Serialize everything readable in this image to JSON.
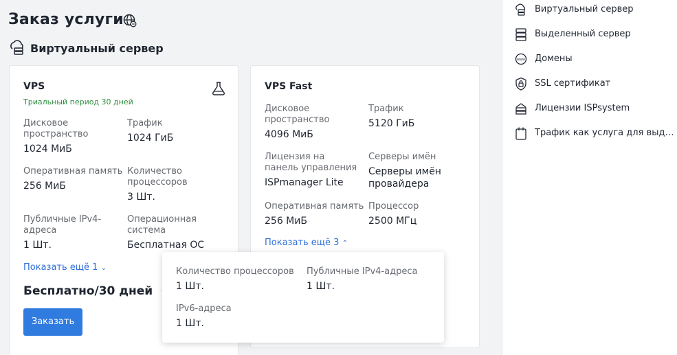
{
  "page": {
    "title": "Заказ услуги",
    "section": "Виртуальный сервер"
  },
  "vps": {
    "name": "VPS",
    "trial": "Триальный период 30 дней",
    "disk_label": "Дисковое пространство",
    "disk_value": "1024 МиБ",
    "traffic_label": "Трафик",
    "traffic_value": "1024 ГиБ",
    "ram_label": "Оперативная память",
    "ram_value": "256 МиБ",
    "cpu_label": "Количество процессоров",
    "cpu_value": "3 Шт.",
    "ipv4_label": "Публичные IPv4-адреса",
    "ipv4_value": "1 Шт.",
    "os_label": "Операционная система",
    "os_value": "Бесплатная ОС",
    "show_more": "Показать ещё 1",
    "price": "Бесплатно/30 дней",
    "order": "Заказать"
  },
  "vps_fast": {
    "name": "VPS Fast",
    "disk_label": "Дисковое пространство",
    "disk_value": "4096 МиБ",
    "traffic_label": "Трафик",
    "traffic_value": "5120 ГиБ",
    "license_label": "Лицензия на панель управления",
    "license_value": "ISPmanager Lite",
    "ns_label": "Серверы имён",
    "ns_value": "Серверы имён провайдера",
    "ram_label": "Оперативная память",
    "ram_value": "256 МиБ",
    "cpu_label": "Процессор",
    "cpu_value": "2500 МГц",
    "show_more": "Показать ещё 3"
  },
  "popup": {
    "cpu_count_label": "Количество процессоров",
    "cpu_count_value": "1 Шт.",
    "ipv4_label": "Публичные IPv4-адреса",
    "ipv4_value": "1 Шт.",
    "ipv6_label": "IPv6-адреса",
    "ipv6_value": "1 Шт."
  },
  "sidebar": {
    "items": [
      {
        "label": "Виртуальный сервер",
        "icon": "cloud-server-icon"
      },
      {
        "label": "Выделенный сервер",
        "icon": "server-icon"
      },
      {
        "label": "Домены",
        "icon": "www-globe-icon"
      },
      {
        "label": "SSL сертификат",
        "icon": "shield-lock-icon"
      },
      {
        "label": "Лицензии ISPsystem",
        "icon": "license-icon"
      },
      {
        "label": "Трафик как услуга для выд…",
        "icon": "traffic-icon"
      }
    ]
  }
}
